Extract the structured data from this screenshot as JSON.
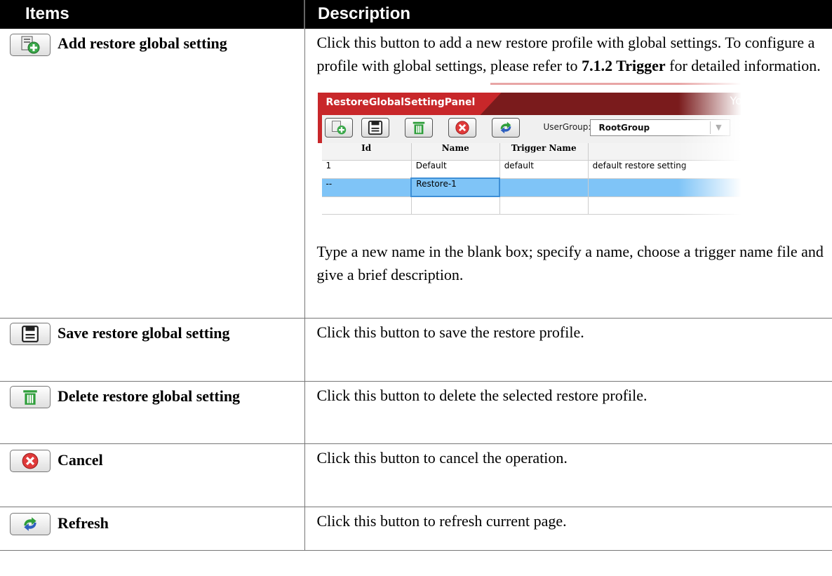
{
  "header": {
    "items": "Items",
    "description": "Description"
  },
  "rows": [
    {
      "item": "Add restore global setting",
      "icon": "add-profile-icon",
      "desc_before": "Click this button to add a new restore profile with global settings. To configure a profile with global settings, please refer to ",
      "desc_bold": "7.1.2 Trigger",
      "desc_after": " for detailed information.",
      "desc2": "Type a new name in the blank box; specify a name, choose a trigger name file and give a brief description."
    },
    {
      "item": "Save restore global setting",
      "icon": "save-icon",
      "desc": "Click this button to save the restore profile."
    },
    {
      "item": "Delete restore global setting",
      "icon": "trash-icon",
      "desc": "Click this button to delete the selected restore profile."
    },
    {
      "item": "Cancel",
      "icon": "cancel-icon",
      "desc": "Click this button to cancel the operation."
    },
    {
      "item": "Refresh",
      "icon": "refresh-icon",
      "desc": "Click this button to refresh current page."
    }
  ],
  "screenshot": {
    "panel_title": "RestoreGlobalSettingPanel",
    "title_right": "Yo",
    "usergroup_label": "UserGroup:",
    "usergroup_value": "RootGroup",
    "columns": [
      "Id",
      "Name",
      "Trigger Name",
      ""
    ],
    "grid_rows": [
      [
        "1",
        "Default",
        "default",
        "default restore setting"
      ],
      [
        "--",
        "Restore-1",
        "",
        ""
      ]
    ]
  },
  "colors": {
    "header_bg": "#000000",
    "panel_red": "#c8272a",
    "selected_row": "#7fc4f7",
    "icon_green": "#2e9e3a"
  }
}
